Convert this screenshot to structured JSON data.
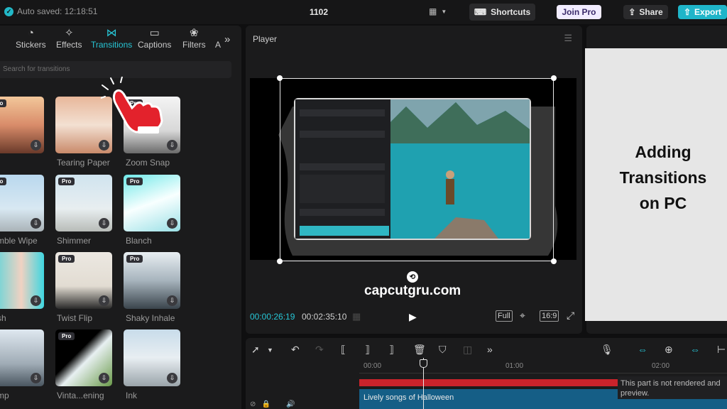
{
  "topbar": {
    "autosave": "Auto saved: 12:18:51",
    "project_title": "1102",
    "shortcuts": "Shortcuts",
    "join_pro": "Join Pro",
    "share": "Share",
    "export": "Export"
  },
  "tabs": [
    {
      "label": "Stickers",
      "icon": "sticker-icon"
    },
    {
      "label": "Effects",
      "icon": "effects-icon"
    },
    {
      "label": "Transitions",
      "icon": "transitions-icon"
    },
    {
      "label": "Captions",
      "icon": "captions-icon"
    },
    {
      "label": "Filters",
      "icon": "filters-icon"
    }
  ],
  "tab_partial": "A",
  "search_placeholder": "Search for transitions",
  "transitions": [
    {
      "label": "t",
      "pro": true
    },
    {
      "label": "Tearing Paper",
      "pro": false
    },
    {
      "label": "Zoom Snap",
      "pro": true
    },
    {
      "label": "mble Wipe",
      "pro": true
    },
    {
      "label": "Shimmer",
      "pro": true
    },
    {
      "label": "Blanch",
      "pro": true
    },
    {
      "label": "sh",
      "pro": false
    },
    {
      "label": "Twist Flip",
      "pro": true
    },
    {
      "label": "Shaky Inhale",
      "pro": true
    },
    {
      "label": "mp",
      "pro": false
    },
    {
      "label": "Vinta...ening",
      "pro": true
    },
    {
      "label": "Ink",
      "pro": false
    }
  ],
  "player": {
    "title": "Player",
    "watermark": "capcutgru.com",
    "current_time": "00:00:26:19",
    "total_time": "00:02:35:10",
    "full": "Full",
    "ratio": "16:9"
  },
  "right_panel": {
    "line1": "Adding",
    "line2": "Transitions",
    "line3": "on PC"
  },
  "timeline": {
    "t0": "00:00",
    "t1": "01:00",
    "t2": "02:00",
    "track_label": "Lively songs of Halloween",
    "tooltip": "This part is not rendered and preview."
  },
  "colors": {
    "accent": "#27c6d6",
    "export": "#1fb5c9",
    "render_bar": "#c9232b",
    "audio_track": "#155e86"
  }
}
